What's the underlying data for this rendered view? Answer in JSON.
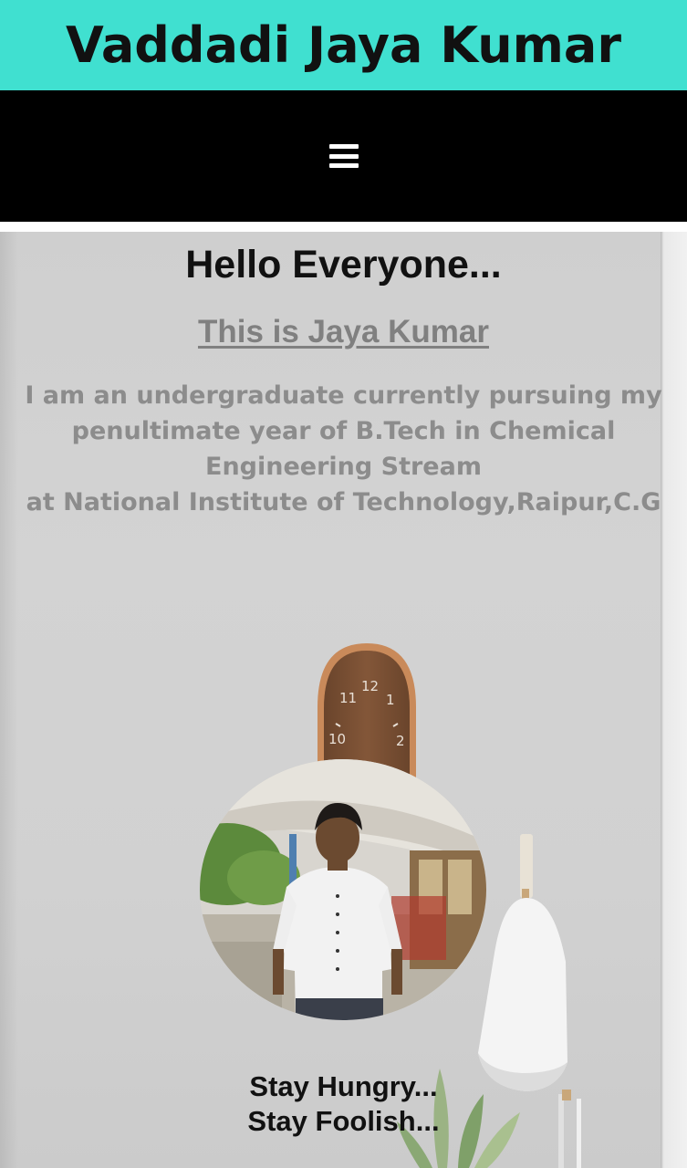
{
  "header": {
    "title": "Vaddadi Jaya Kumar",
    "background_color": "#40e0d0"
  },
  "nav": {
    "menu_icon": "hamburger-menu-icon",
    "background_color": "#000000"
  },
  "main": {
    "greeting": "Hello Everyone...",
    "intro": "This is Jaya Kumar",
    "bio_lines": [
      "I am an undergraduate currently pursuing my",
      "penultimate year of B.Tech in Chemical",
      "Engineering Stream",
      "at National Institute of Technology,Raipur,C.G"
    ],
    "motto_lines": [
      "Stay Hungry...",
      "Stay Foolish..."
    ],
    "clock_numerals": [
      "12",
      "11",
      "10",
      "1",
      "2"
    ]
  }
}
